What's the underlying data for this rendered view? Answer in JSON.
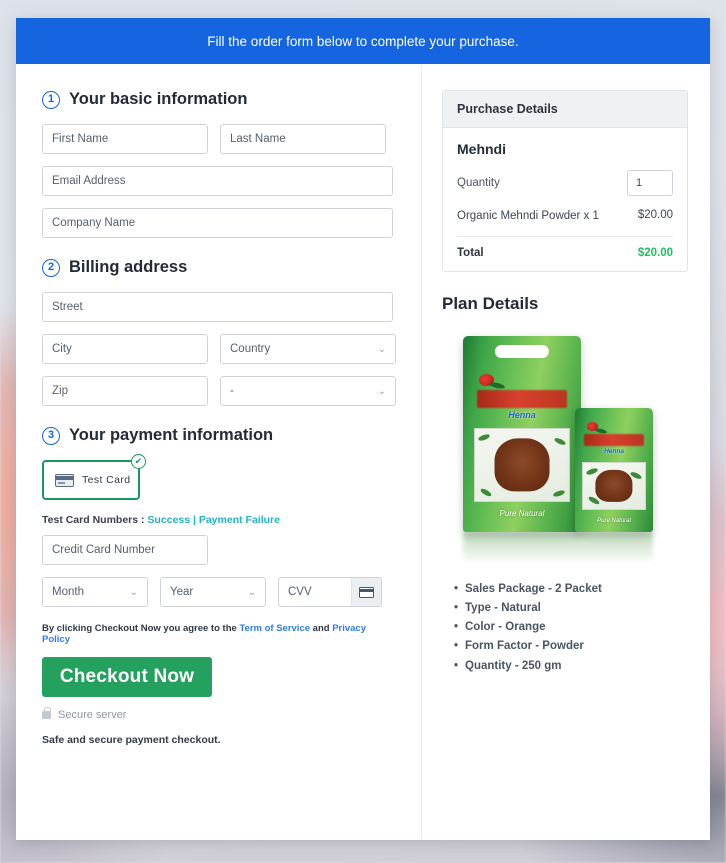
{
  "banner": {
    "text": "Fill the order form below to complete your purchase."
  },
  "sections": {
    "basic": {
      "step": "1",
      "title": "Your basic information",
      "fields": {
        "first_name": "First Name",
        "last_name": "Last Name",
        "email": "Email Address",
        "company": "Company Name"
      }
    },
    "billing": {
      "step": "2",
      "title": "Billing address",
      "fields": {
        "street": "Street",
        "city": "City",
        "country": "Country",
        "zip": "Zip",
        "state": "-"
      }
    },
    "payment": {
      "step": "3",
      "title": "Your payment information",
      "card_option": "Test  Card",
      "test_numbers_label": "Test Card Numbers :",
      "test_success_link": "Success",
      "test_separator": "|",
      "test_failure_link": "Payment Failure",
      "card_number": "Credit Card Number",
      "month": "Month",
      "year": "Year",
      "cvv": "CVV",
      "agree_prefix": "By clicking Checkout Now you agree to the",
      "terms_link": "Term of Service",
      "agree_and": "and",
      "privacy_link": "Privacy Policy",
      "checkout_button": "Checkout Now",
      "secure_server": "Secure server",
      "safe_note": "Safe and secure payment checkout."
    }
  },
  "purchase_details": {
    "header": "Purchase Details",
    "product_name": "Mehndi",
    "quantity_label": "Quantity",
    "quantity_value": "1",
    "line_item_name": "Organic Mehndi Powder x 1",
    "line_item_price": "$20.00",
    "total_label": "Total",
    "total_value": "$20.00"
  },
  "plan_details": {
    "title": "Plan Details",
    "product_brand": "Henna",
    "product_tagline": "Pure Natural",
    "specs": [
      "Sales Package - 2 Packet",
      "Type - Natural",
      "Color - Orange",
      "Form Factor - Powder",
      "Quantity - 250 gm"
    ]
  },
  "colors": {
    "banner_blue": "#1565e0",
    "accent_blue": "#2f7de1",
    "checkout_green": "#25a15f",
    "total_green": "#1fbf5e",
    "card_border_green": "#17995e",
    "link_teal": "#23b3c4"
  },
  "icons": {
    "chevron": "⌄",
    "check": "✔"
  }
}
